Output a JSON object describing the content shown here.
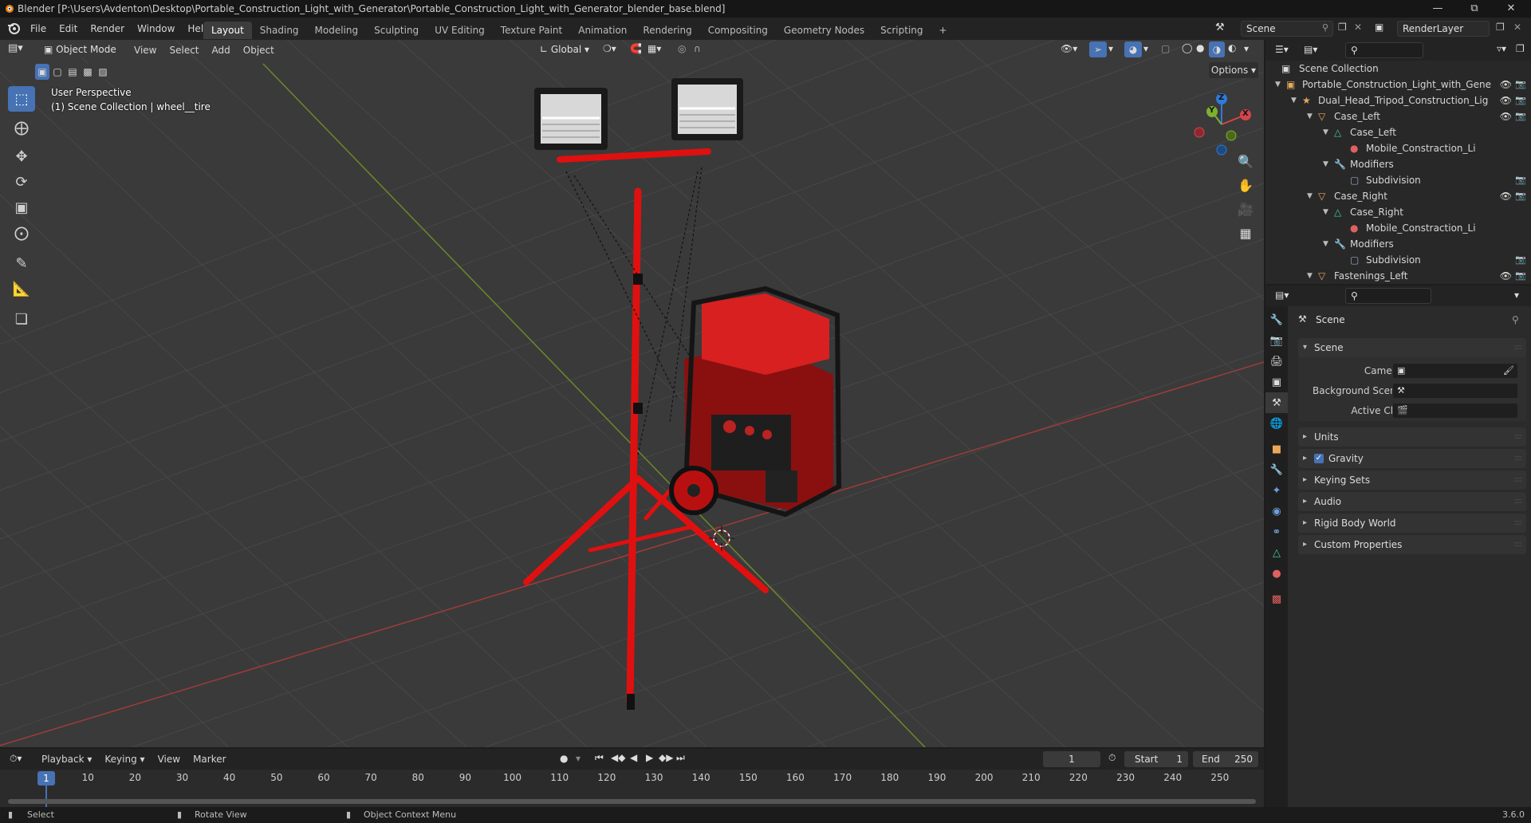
{
  "window": {
    "title": "Blender [P:\\Users\\Avdenton\\Desktop\\Portable_Construction_Light_with_Generator\\Portable_Construction_Light_with_Generator_blender_base.blend]",
    "minimize_icon": "minimize-icon",
    "maximize_icon": "maximize-icon",
    "close_icon": "close-icon"
  },
  "menu": {
    "items": [
      "File",
      "Edit",
      "Render",
      "Window",
      "Help"
    ]
  },
  "workspaces": {
    "tabs": [
      "Layout",
      "Shading",
      "Modeling",
      "Sculpting",
      "UV Editing",
      "Texture Paint",
      "Animation",
      "Rendering",
      "Compositing",
      "Geometry Nodes",
      "Scripting"
    ],
    "active": "Layout",
    "add_label": "+"
  },
  "scene_selector": {
    "value": "Scene"
  },
  "view_layer": {
    "value": "RenderLayer"
  },
  "viewport_header": {
    "mode": "Object Mode",
    "menus": [
      "View",
      "Select",
      "Add",
      "Object"
    ],
    "transform_orientation": "Global",
    "options_label": "Options"
  },
  "viewport": {
    "view_name": "User Perspective",
    "collection_info": "(1) Scene Collection | wheel__tire",
    "axis_x": "X",
    "axis_y": "Y",
    "axis_z": "Z"
  },
  "outliner": {
    "root": "Scene Collection",
    "rows": [
      {
        "label": "Portable_Construction_Light_with_Gene",
        "indent": 0,
        "icon": "collection-icon",
        "icon_color": "#e8a85a",
        "exp": "▼",
        "vis": true,
        "cam": true
      },
      {
        "label": "Dual_Head_Tripod_Construction_Lig",
        "indent": 1,
        "icon": "armature-icon",
        "icon_color": "#e8a85a",
        "exp": "▼",
        "vis": true,
        "cam": true
      },
      {
        "label": "Case_Left",
        "indent": 2,
        "icon": "object-icon",
        "icon_color": "#e8a85a",
        "exp": "▼",
        "vis": true,
        "cam": true
      },
      {
        "label": "Case_Left",
        "indent": 3,
        "icon": "mesh-icon",
        "icon_color": "#46c7a8",
        "exp": "▼",
        "vis": false,
        "cam": false
      },
      {
        "label": "Mobile_Constraction_Li",
        "indent": 4,
        "icon": "material-icon",
        "icon_color": "#e06060",
        "exp": "",
        "vis": false,
        "cam": false
      },
      {
        "label": "Modifiers",
        "indent": 3,
        "icon": "wrench-icon",
        "icon_color": "#6fa0e0",
        "exp": "▼",
        "vis": false,
        "cam": false
      },
      {
        "label": "Subdivision",
        "indent": 4,
        "icon": "modifier-icon",
        "icon_color": "#9aa7c7",
        "exp": "",
        "vis": false,
        "cam": true
      },
      {
        "label": "Case_Right",
        "indent": 2,
        "icon": "object-icon",
        "icon_color": "#e8a85a",
        "exp": "▼",
        "vis": true,
        "cam": true
      },
      {
        "label": "Case_Right",
        "indent": 3,
        "icon": "mesh-icon",
        "icon_color": "#46c7a8",
        "exp": "▼",
        "vis": false,
        "cam": false
      },
      {
        "label": "Mobile_Constraction_Li",
        "indent": 4,
        "icon": "material-icon",
        "icon_color": "#e06060",
        "exp": "",
        "vis": false,
        "cam": false
      },
      {
        "label": "Modifiers",
        "indent": 3,
        "icon": "wrench-icon",
        "icon_color": "#6fa0e0",
        "exp": "▼",
        "vis": false,
        "cam": false
      },
      {
        "label": "Subdivision",
        "indent": 4,
        "icon": "modifier-icon",
        "icon_color": "#9aa7c7",
        "exp": "",
        "vis": false,
        "cam": true
      },
      {
        "label": "Fastenings_Left",
        "indent": 2,
        "icon": "object-icon",
        "icon_color": "#e8a85a",
        "exp": "▼",
        "vis": true,
        "cam": true
      }
    ]
  },
  "properties": {
    "context_title": "Scene",
    "scene_panel": {
      "title": "Scene",
      "fields": [
        {
          "label": "Camera"
        },
        {
          "label": "Background Scene"
        },
        {
          "label": "Active Clip"
        }
      ]
    },
    "panels": [
      "Units",
      "Gravity",
      "Keying Sets",
      "Audio",
      "Rigid Body World",
      "Custom Properties"
    ],
    "gravity_checked": true
  },
  "timeline": {
    "menus": [
      "Playback",
      "Keying",
      "View",
      "Marker"
    ],
    "current_frame": "1",
    "start_label": "Start",
    "start_value": "1",
    "end_label": "End",
    "end_value": "250",
    "ruler_ticks": [
      "10",
      "20",
      "30",
      "40",
      "50",
      "60",
      "70",
      "80",
      "90",
      "100",
      "110",
      "120",
      "130",
      "140",
      "150",
      "160",
      "170",
      "180",
      "190",
      "200",
      "210",
      "220",
      "230",
      "240",
      "250"
    ],
    "playhead_label": "1"
  },
  "statusbar": {
    "select": "Select",
    "rotate": "Rotate View",
    "context_menu": "Object Context Menu",
    "version": "3.6.0"
  },
  "colors": {
    "accent": "#4772b3",
    "grid_x_axis": "#a13a3a",
    "grid_y_axis": "#6a8a2a",
    "tripod_red": "#e01010"
  }
}
